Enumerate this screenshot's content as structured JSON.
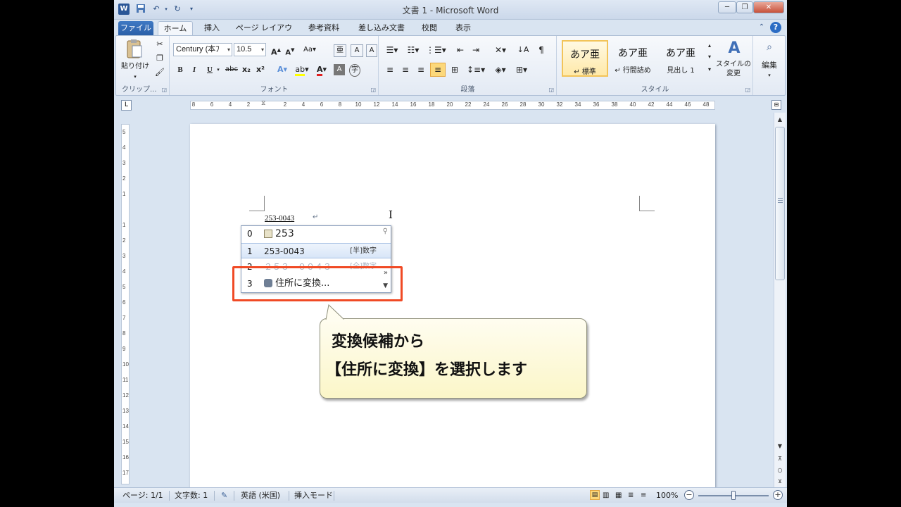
{
  "window": {
    "title": "文書 1 - Microsoft Word",
    "quick_access": [
      "save-icon",
      "undo-icon",
      "redo-icon",
      "customize-icon"
    ]
  },
  "tabs": [
    {
      "label": "ファイル"
    },
    {
      "label": "ホーム"
    },
    {
      "label": "挿入"
    },
    {
      "label": "ページ レイアウト"
    },
    {
      "label": "参考資料"
    },
    {
      "label": "差し込み文書"
    },
    {
      "label": "校閲"
    },
    {
      "label": "表示"
    }
  ],
  "ribbon": {
    "clipboard": {
      "paste_label": "貼り付け",
      "group_label": "クリップ..."
    },
    "font": {
      "font_name": "Century (本ﾌ",
      "font_size": "10.5",
      "group_label": "フォント",
      "buttons": [
        "B",
        "I",
        "U",
        "abc",
        "x₂",
        "x²"
      ]
    },
    "paragraph": {
      "group_label": "段落"
    },
    "styles": {
      "items": [
        {
          "sample": "あア亜",
          "name": "↵ 標準"
        },
        {
          "sample": "あア亜",
          "name": "↵ 行間詰め"
        },
        {
          "sample": "あア亜",
          "name": "見出し 1"
        }
      ],
      "change_label_1": "スタイルの",
      "change_label_2": "変更",
      "group_label": "スタイル"
    },
    "editing": {
      "label": "編集"
    }
  },
  "ruler": {
    "h_numbers": [
      "8",
      "6",
      "4",
      "2",
      "",
      "2",
      "4",
      "6",
      "8",
      "10",
      "12",
      "14",
      "16",
      "18",
      "20",
      "22",
      "24",
      "26",
      "28",
      "30",
      "32",
      "34",
      "36",
      "38",
      "40",
      "42",
      "44",
      "46",
      "48"
    ],
    "v_numbers": [
      "5",
      "4",
      "3",
      "2",
      "1",
      "",
      "1",
      "2",
      "3",
      "4",
      "5",
      "6",
      "7",
      "8",
      "9",
      "10",
      "11",
      "12",
      "13",
      "14",
      "15",
      "16",
      "17"
    ]
  },
  "document": {
    "typed_text": "253-0043",
    "paragraph_mark": "↵"
  },
  "ime": {
    "candidates": [
      {
        "num": "0",
        "text": "253",
        "tag": ""
      },
      {
        "num": "1",
        "text": "253-0043",
        "tag": "[半]数字"
      },
      {
        "num": "2",
        "text": "２５３－００４３",
        "tag": "[全]数字"
      },
      {
        "num": "3",
        "text": "住所に変換...",
        "tag": ""
      }
    ]
  },
  "callout": {
    "line1": "変換候補から",
    "line2": "【住所に変換】を選択します"
  },
  "statusbar": {
    "page": "ページ: 1/1",
    "words": "文字数: 1",
    "language": "英語 (米国)",
    "mode": "挿入モード",
    "zoom": "100%",
    "zoom_level": 1.0
  },
  "colors": {
    "highlight_border": "#f04a25",
    "callout_fill": "#fbf6c8",
    "file_tab": "#2b5fa8"
  }
}
